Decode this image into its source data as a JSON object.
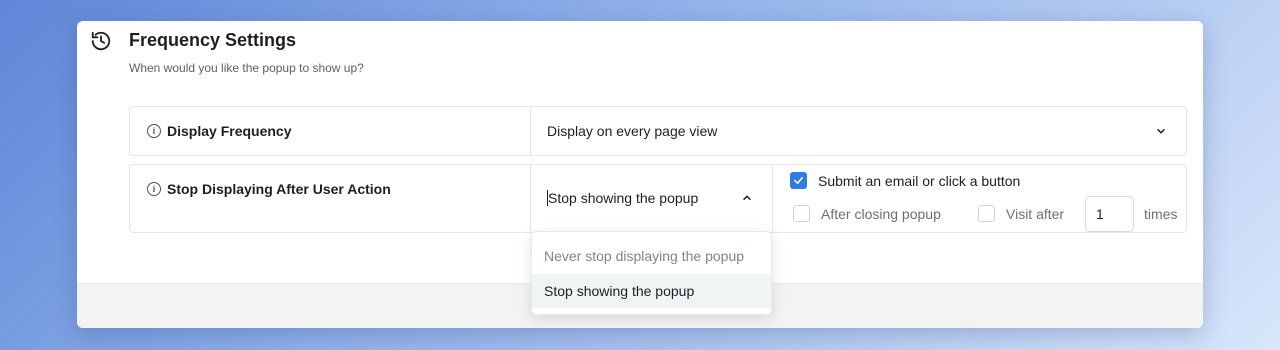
{
  "header": {
    "title": "Frequency Settings",
    "subtitle": "When would you like the popup to show up?"
  },
  "display_frequency": {
    "label": "Display Frequency",
    "value": "Display on every page view"
  },
  "stop_displaying": {
    "label": "Stop Displaying After User Action",
    "value": "Stop showing the popup",
    "dropdown_options": [
      "Never stop displaying the popup",
      "Stop showing the popup"
    ],
    "actions": {
      "submit_label": "Submit an email or click a button",
      "submit_checked": true,
      "after_closing_label": "After closing popup",
      "after_closing_checked": false,
      "visit_after_label": "Visit after",
      "visit_after_checked": false,
      "visit_count": "1",
      "times_label": "times"
    }
  },
  "colors": {
    "accent": "#2f7de1",
    "muted_text": "#7d8591"
  },
  "icons": [
    "history-icon",
    "info-icon",
    "chevron-down-icon",
    "chevron-up-icon",
    "checkmark-icon"
  ]
}
